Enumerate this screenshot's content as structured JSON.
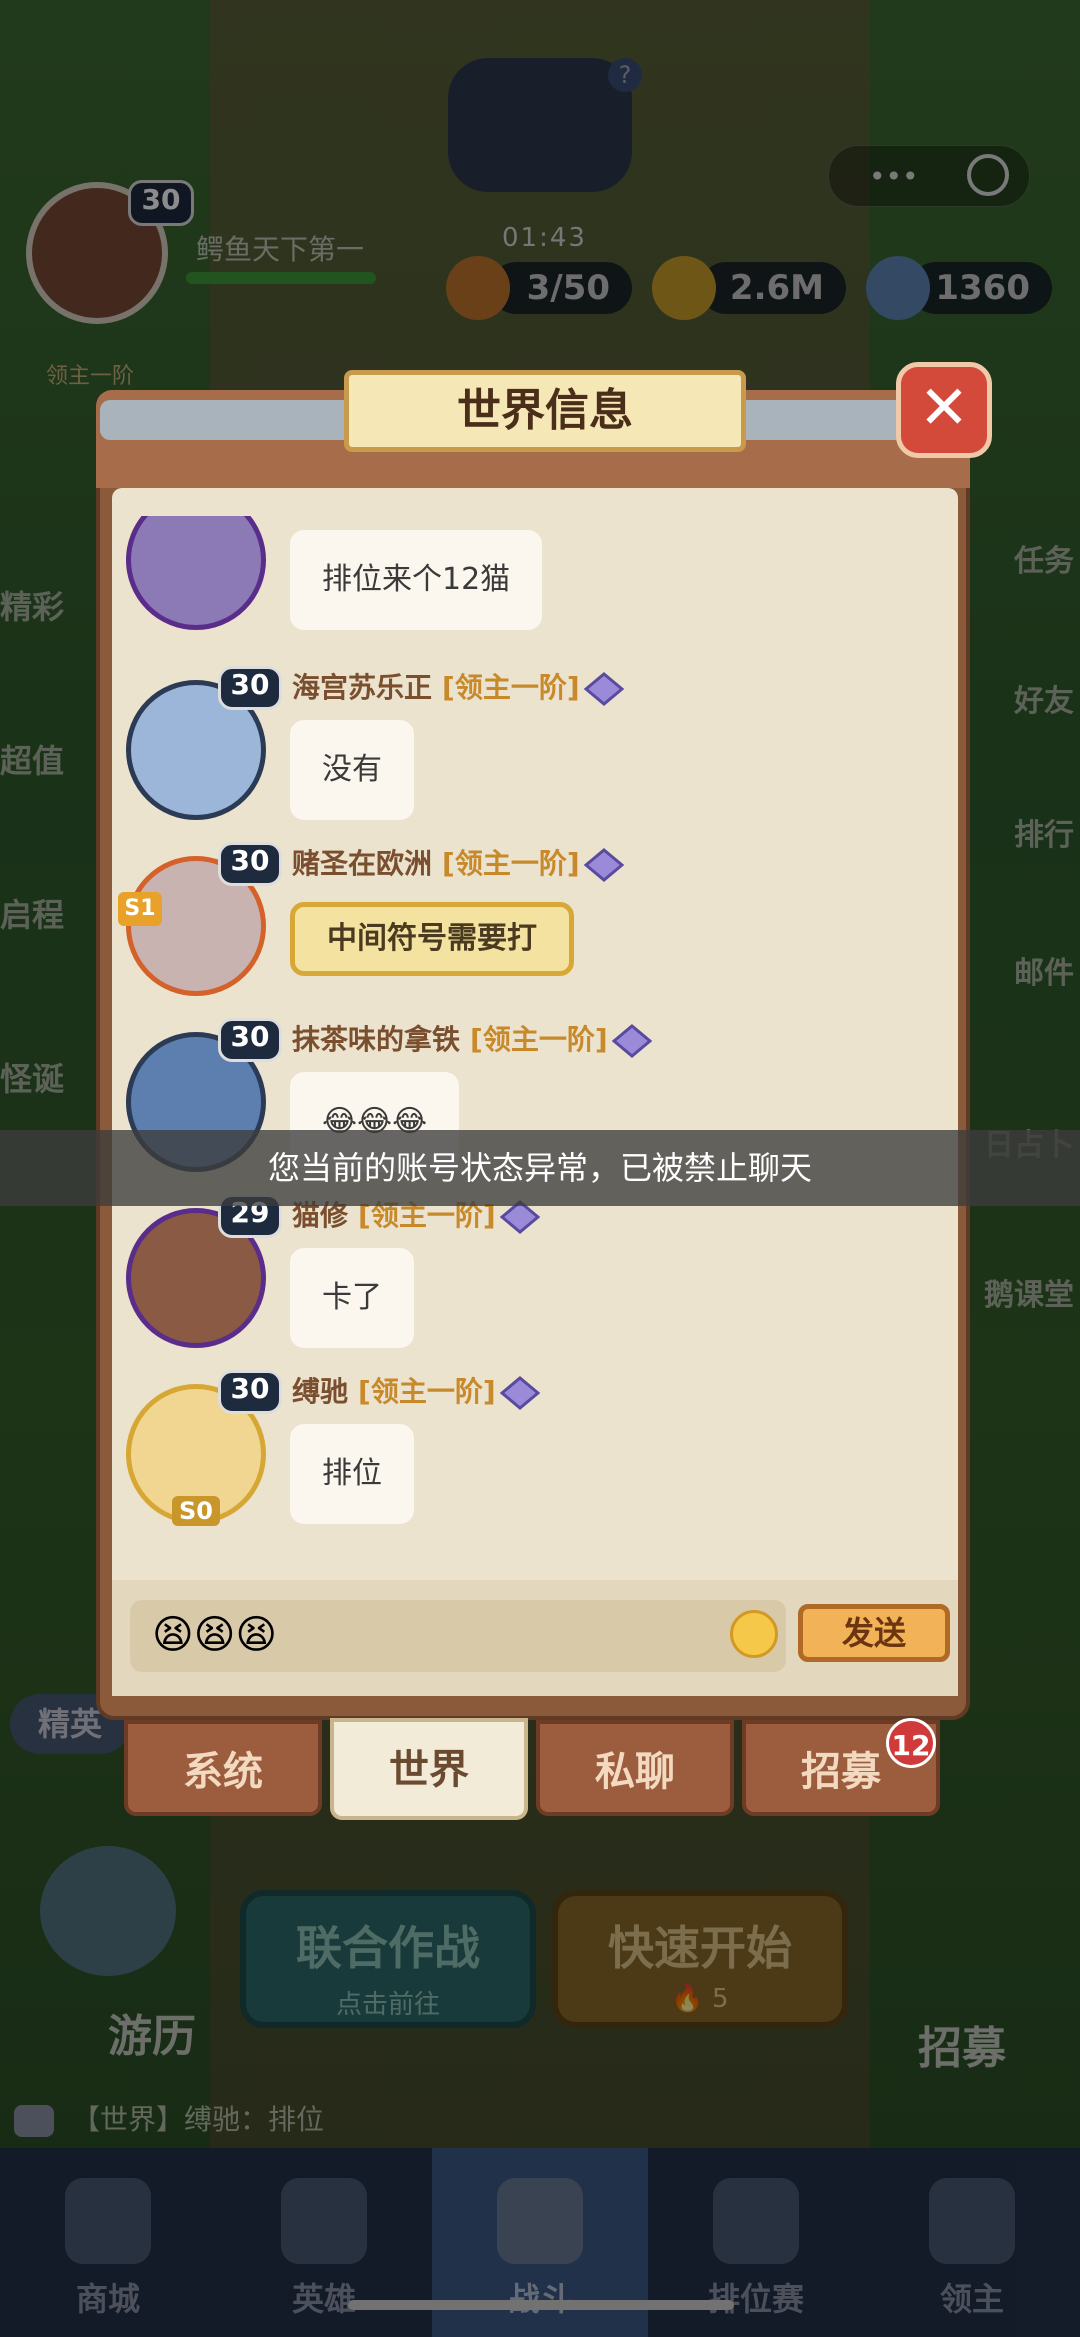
{
  "top": {
    "player_name": "鳄鱼天下第一",
    "player_level": "30",
    "rank_label": "领主一阶",
    "timer": "01:43",
    "energy": "3/50",
    "gold": "2.6M",
    "gems": "1360",
    "help": "?"
  },
  "side_left": [
    "精彩",
    "超值",
    "启程",
    "怪诞"
  ],
  "side_right": [
    "任务",
    "好友",
    "排行",
    "邮件",
    "日占卜",
    "鹅课堂"
  ],
  "modal": {
    "title": "世界信息",
    "close": "✕",
    "messages": [
      {
        "level": "30",
        "name": "",
        "rank": "",
        "text": "排位来个12猫",
        "gold": false
      },
      {
        "level": "30",
        "name": "海宫苏乐正",
        "rank": "[领主一阶]",
        "text": "没有",
        "gold": false
      },
      {
        "level": "30",
        "name": "赌圣在欧洲",
        "rank": "[领主一阶]",
        "text": "中间符号需要打",
        "gold": true,
        "badge": "S1"
      },
      {
        "level": "30",
        "name": "抹茶味的拿铁",
        "rank": "[领主一阶]",
        "text": "😂😂😂",
        "gold": false
      },
      {
        "level": "29",
        "name": "猫修",
        "rank": "[领主一阶]",
        "text": "卡了",
        "gold": false
      },
      {
        "level": "30",
        "name": "缚驰",
        "rank": "[领主一阶]",
        "text": "排位",
        "gold": false,
        "badge": "S0"
      }
    ],
    "toast": "您当前的账号状态异常，已被禁止聊天",
    "input_value": "😫😫😫",
    "send": "发送",
    "tabs": [
      "系统",
      "世界",
      "私聊",
      "招募"
    ],
    "recruit_badge": "12"
  },
  "bottom": {
    "left_label": "精英",
    "travel": "游历",
    "recruit": "招募",
    "coop_title": "联合作战",
    "coop_sub": "点击前往",
    "quick_title": "快速开始",
    "quick_cost": "5",
    "chat_preview": "【世界】缚驰：排位"
  },
  "nav": [
    "商城",
    "英雄",
    "战斗",
    "排位赛",
    "领主"
  ],
  "colors": {
    "panel": "#ebe3cd",
    "frame": "#8a5a3a",
    "accent": "#d44a3a",
    "nav": "#24314a"
  }
}
